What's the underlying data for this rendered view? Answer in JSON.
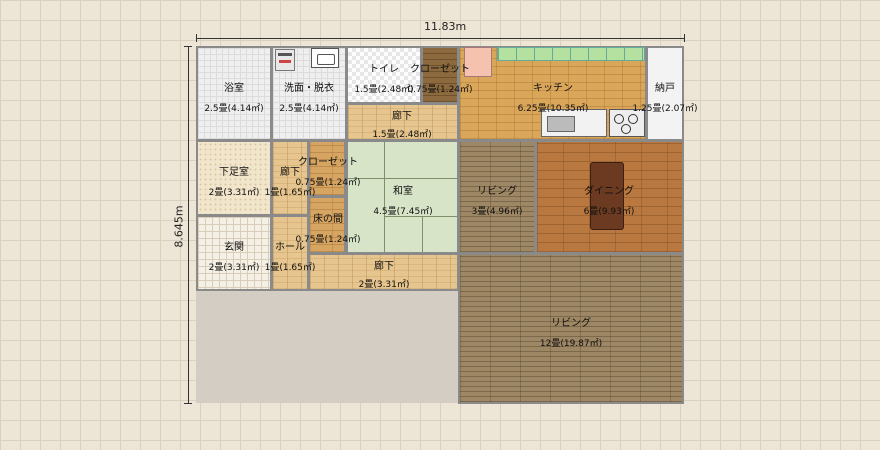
{
  "dimensions": {
    "width_label": "11.83m",
    "height_label": "8.645m"
  },
  "rooms": [
    {
      "id": "bath",
      "name": "浴室",
      "area": "2.5畳(4.14㎡)"
    },
    {
      "id": "washroom",
      "name": "洗面・脱衣",
      "area": "2.5畳(4.14㎡)"
    },
    {
      "id": "toilet",
      "name": "トイレ",
      "area": "1.5畳(2.48㎡)"
    },
    {
      "id": "closet_top",
      "name": "クローゼット",
      "area": "0.75畳(1.24㎡)"
    },
    {
      "id": "kitchen",
      "name": "キッチン",
      "area": "6.25畳(10.35㎡)"
    },
    {
      "id": "storage",
      "name": "納戸",
      "area": "1.25畳(2.07㎡)"
    },
    {
      "id": "hall_top",
      "name": "廊下",
      "area": "1.5畳(2.48㎡)"
    },
    {
      "id": "shoe_room",
      "name": "下足室",
      "area": "2畳(3.31㎡)"
    },
    {
      "id": "hall_mid",
      "name": "廊下",
      "area": "1畳(1.65㎡)"
    },
    {
      "id": "closet_mid",
      "name": "クローゼット",
      "area": "0.75畳(1.24㎡)"
    },
    {
      "id": "washitsu",
      "name": "和室",
      "area": "4.5畳(7.45㎡)"
    },
    {
      "id": "living_small",
      "name": "リビング",
      "area": "3畳(4.96㎡)"
    },
    {
      "id": "dining",
      "name": "ダイニング",
      "area": "6畳(9.93㎡)"
    },
    {
      "id": "tokonoma",
      "name": "床の間",
      "area": "0.75畳(1.24㎡)"
    },
    {
      "id": "entrance",
      "name": "玄関",
      "area": "2畳(3.31㎡)"
    },
    {
      "id": "hole",
      "name": "ホール",
      "area": "1畳(1.65㎡)"
    },
    {
      "id": "hall_bottom",
      "name": "廊下",
      "area": "2畳(3.31㎡)"
    },
    {
      "id": "living_big",
      "name": "リビング",
      "area": "12畳(19.87㎡)"
    }
  ]
}
